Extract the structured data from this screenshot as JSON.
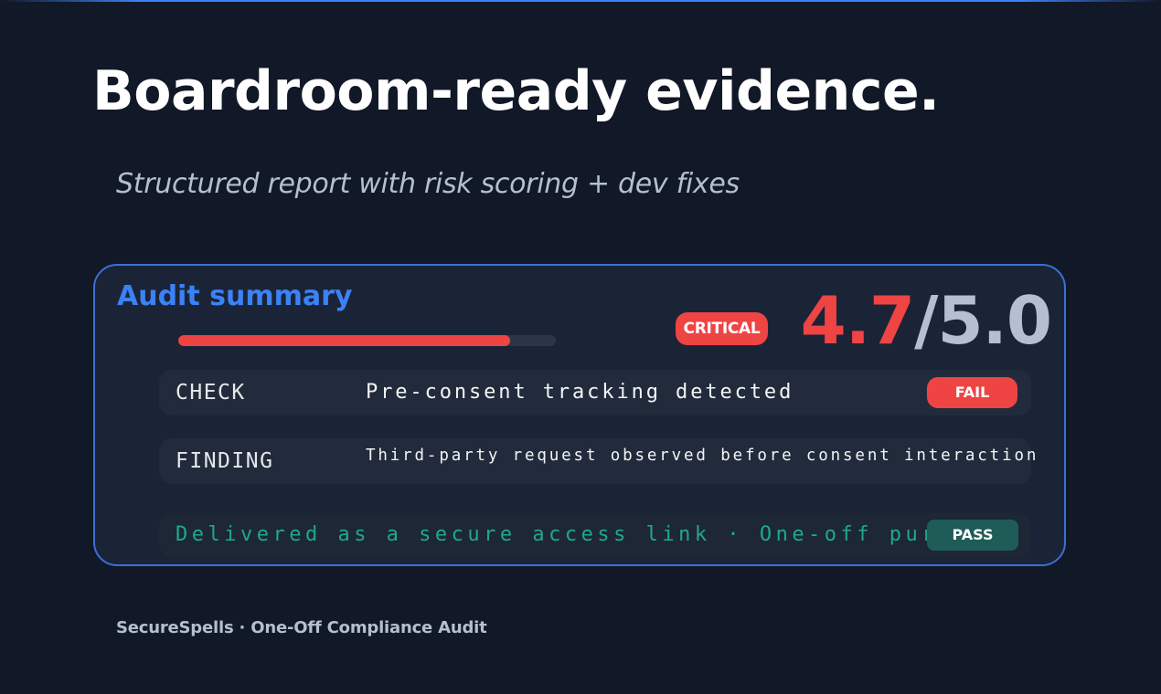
{
  "headline": "Boardroom-ready evidence.",
  "subtitle": "Structured report with risk scoring + dev fixes",
  "audit_card": {
    "title": "Audit summary",
    "risk_level": 0.88,
    "severity_badge": "CRITICAL",
    "score": {
      "value": "4.7",
      "separator": "/",
      "max": "5.0"
    },
    "rows": [
      {
        "label": "CHECK",
        "text": "Pre-consent tracking detected",
        "status": "FAIL"
      },
      {
        "label": "FINDING",
        "text": "Third-party request observed before consent interaction"
      }
    ],
    "delivery": {
      "text": "Delivered as a secure access link · One-off purchase",
      "status": "PASS"
    }
  },
  "footer": "SecureSpells · One-Off Compliance Audit",
  "colors": {
    "background": "#111827",
    "accent_blue": "#3b82f6",
    "critical_red": "#ef4444",
    "pass_teal": "#1f5c57",
    "delivery_green": "#1fa88c"
  }
}
